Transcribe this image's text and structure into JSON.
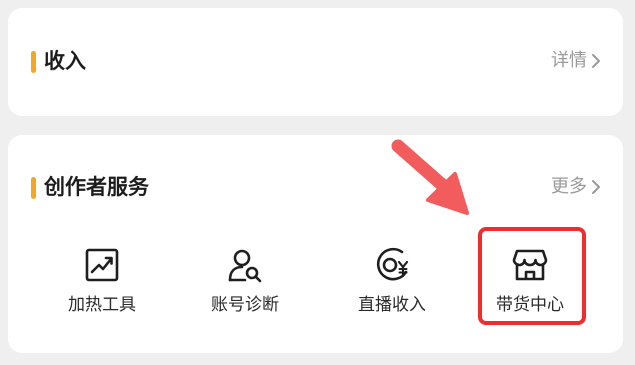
{
  "income": {
    "title": "收入",
    "link": "详情"
  },
  "services": {
    "title": "创作者服务",
    "link": "更多",
    "items": [
      {
        "label": "加热工具",
        "icon": "trend-chart-icon"
      },
      {
        "label": "账号诊断",
        "icon": "user-search-icon"
      },
      {
        "label": "直播收入",
        "icon": "live-yuan-icon"
      },
      {
        "label": "带货中心",
        "icon": "storefront-icon"
      }
    ]
  },
  "annotation": {
    "highlight_color": "#ee2d2d",
    "arrow_color": "#f25c5c",
    "accent_color": "#f5a623"
  }
}
